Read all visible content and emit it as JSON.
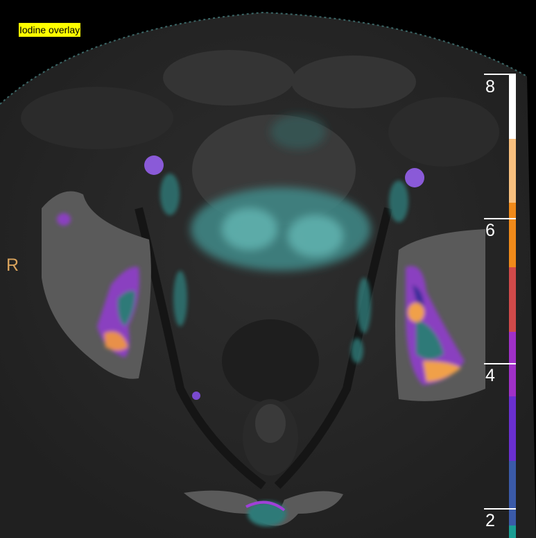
{
  "image": {
    "overlay_label": "Iodine overlay",
    "orientation_label": "R"
  },
  "colorbar": {
    "labels": [
      "8",
      "6",
      "4",
      "2"
    ],
    "segments": [
      "#ffffff",
      "#f8c07f",
      "#f08a1a",
      "#d04a4a",
      "#a030c8",
      "#6a2fd0",
      "#3a5aa8",
      "#1a9e94"
    ]
  }
}
